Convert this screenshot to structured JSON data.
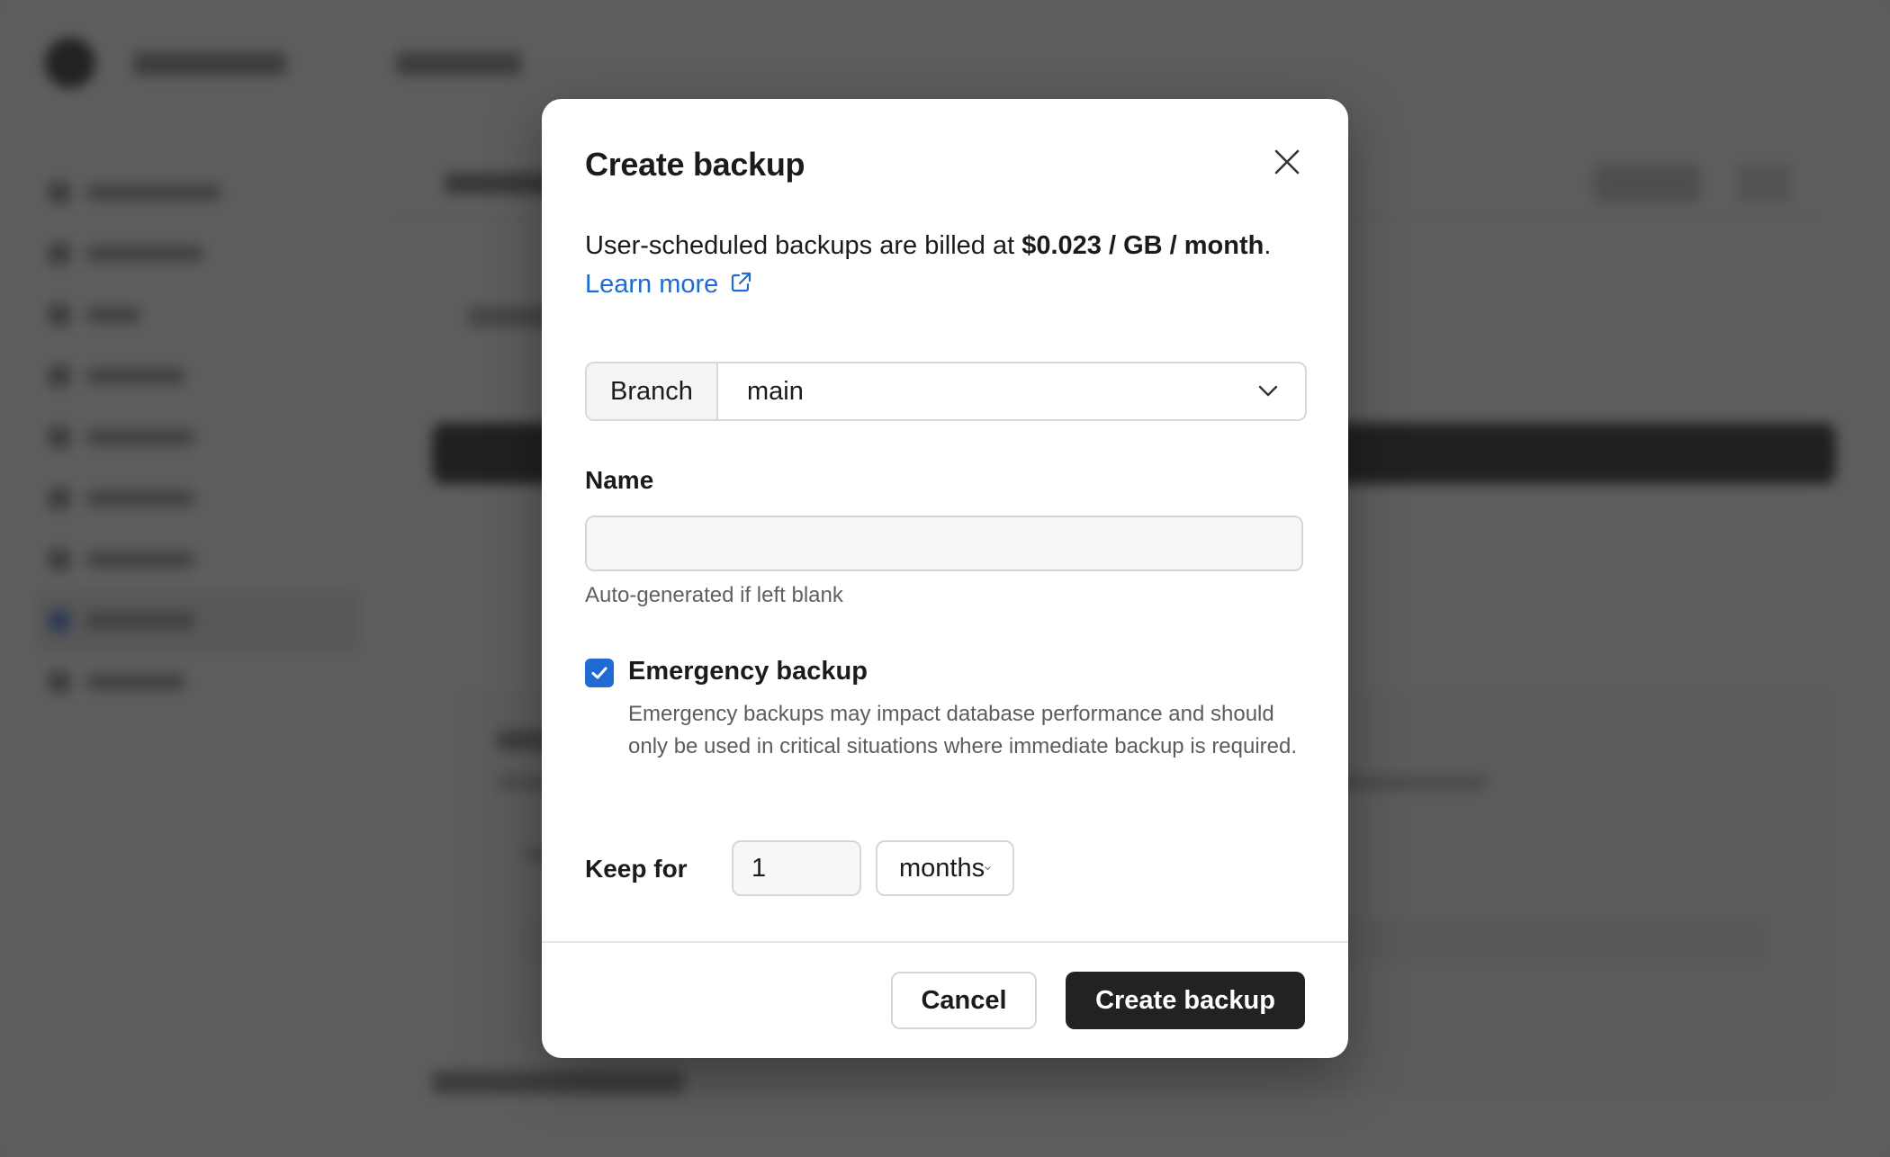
{
  "modal": {
    "title": "Create backup",
    "close_icon": "close-icon",
    "billing": {
      "prefix": "User-scheduled backups are billed at ",
      "price": "$0.023 / GB / month",
      "suffix": ".",
      "learn_more": "Learn more",
      "learn_more_icon": "external-link-icon"
    },
    "branch": {
      "label": "Branch",
      "value": "main"
    },
    "name": {
      "label": "Name",
      "value": "",
      "placeholder": "",
      "help": "Auto-generated if left blank"
    },
    "emergency": {
      "checked": true,
      "label": "Emergency backup",
      "description": "Emergency backups may impact database performance and should only be used in critical situations where immediate backup is required."
    },
    "keep_for": {
      "label": "Keep for",
      "value": "1",
      "unit": "months"
    },
    "actions": {
      "cancel": "Cancel",
      "create": "Create backup"
    }
  },
  "colors": {
    "accent": "#1f6bd2",
    "primary_button": "#222222",
    "overlay": "#282828"
  }
}
